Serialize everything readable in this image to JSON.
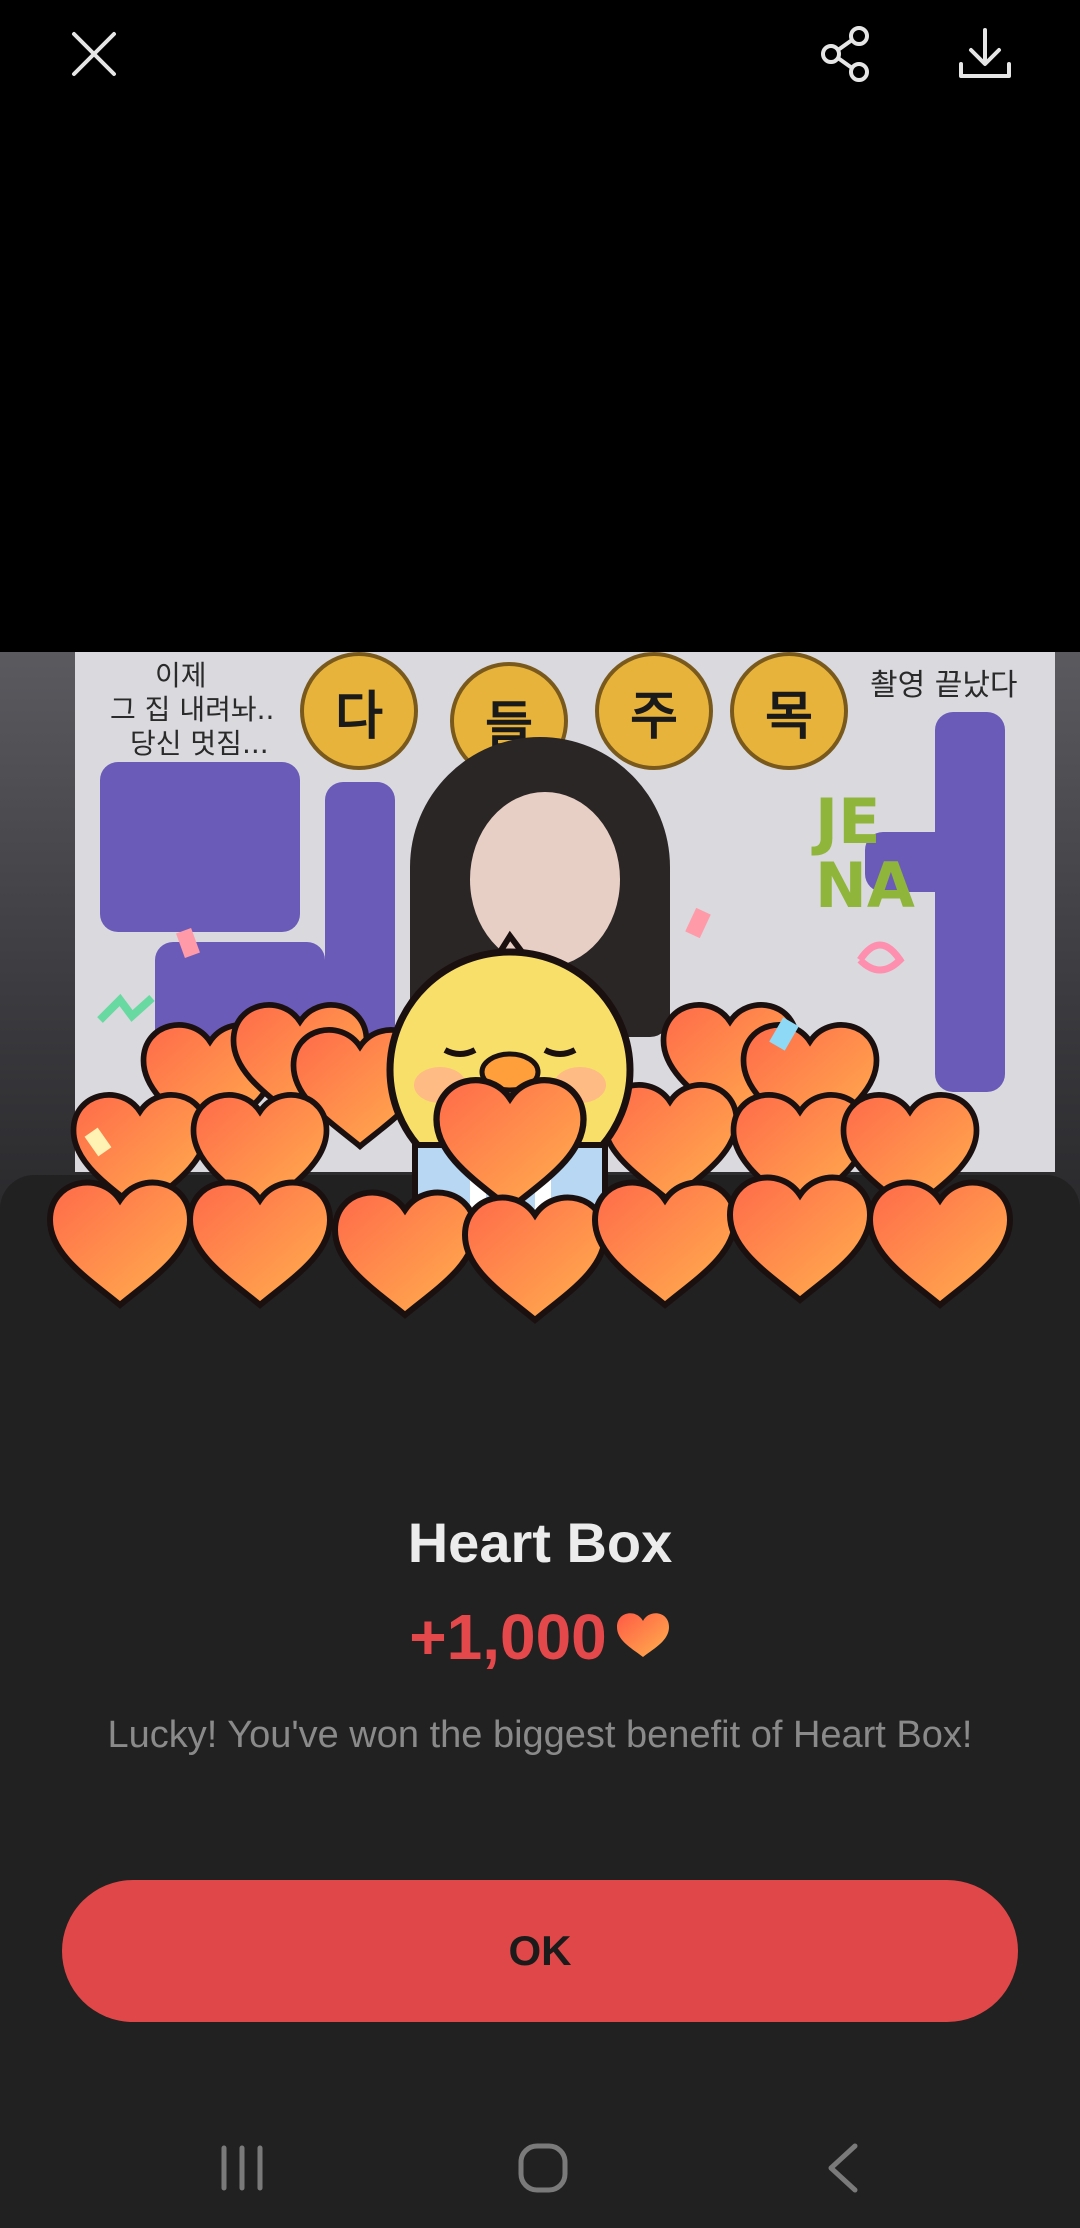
{
  "topbar": {
    "close_icon": "close-icon",
    "share_icon": "share-icon",
    "download_icon": "download-icon"
  },
  "photo": {
    "banner_text_1": "이제",
    "banner_text_2": "그 집 내려놔..",
    "banner_text_3": "당신 멋짐...",
    "banner_text_4": "촬영 끝났다",
    "circle_chars": [
      "다",
      "들",
      "주",
      "목"
    ],
    "sign_letters": "JE NA"
  },
  "dialog": {
    "title": "Heart Box",
    "reward_amount": "+1,000",
    "reward_icon": "heart-icon",
    "message": "Lucky! You've won the biggest benefit of Heart Box!",
    "ok_label": "OK"
  },
  "colors": {
    "accent": "#e04748",
    "sheet_bg": "#212121",
    "reward_text": "#e5484a"
  },
  "navbar": {
    "recents_icon": "recents-icon",
    "home_icon": "home-icon",
    "back_icon": "back-icon"
  }
}
